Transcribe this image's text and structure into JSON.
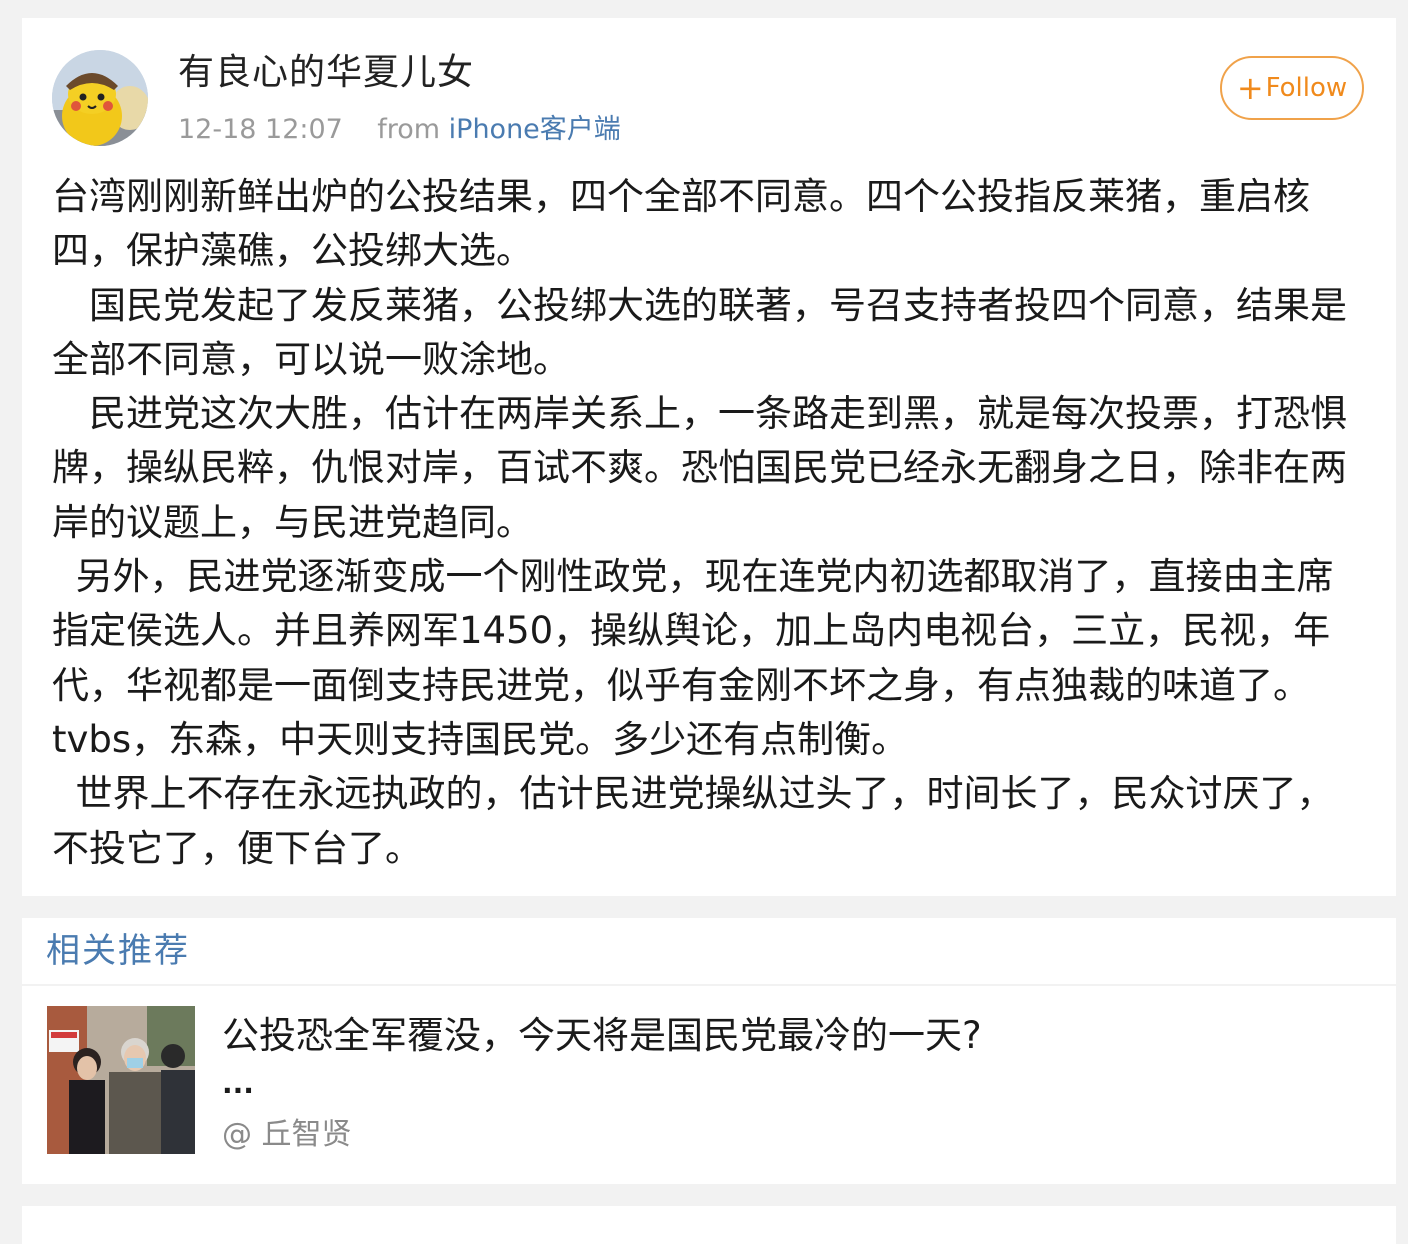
{
  "post": {
    "username": "有良心的华夏儿女",
    "timestamp": "12-18 12:07",
    "from_label": "from",
    "source": "iPhone客户端",
    "follow_label": "Follow",
    "paragraphs": [
      "台湾刚刚新鲜出炉的公投结果，四个全部不同意。四个公投指反莱猪，重启核四，保护藻礁，公投绑大选。",
      "　国民党发起了发反莱猪，公投绑大选的联著，号召支持者投四个同意，结果是全部不同意，可以说一败涂地。",
      "　民进党这次大胜，估计在两岸关系上，一条路走到黑，就是每次投票，打恐惧牌，操纵民粹，仇恨对岸，百试不爽。恐怕国民党已经永无翻身之日，除非在两岸的议题上，与民进党趋同。",
      "  另外，民进党逐渐变成一个刚性政党，现在连党内初选都取消了，直接由主席指定侯选人。并且养网军1450，操纵舆论，加上岛内电视台，三立，民视，年代，华视都是一面倒支持民进党，似乎有金刚不坏之身，有点独裁的味道了。tvbs，东森，中天则支持国民党。多少还有点制衡。",
      "  世界上不存在永远执政的，估计民进党操纵过头了，时间长了，民众讨厌了，不投它了，便下台了。"
    ]
  },
  "related": {
    "section_title": "相关推荐",
    "items": [
      {
        "title": "公投恐全军覆没，今天将是国民党最冷的一天?",
        "ellipsis": "...",
        "author": "@ 丘智贤"
      }
    ]
  },
  "icons": {
    "follow": "plus-icon",
    "avatar": "avatar-image",
    "thumbnail": "news-thumbnail-image"
  },
  "colors": {
    "link_blue": "#4a7bb0",
    "follow_orange": "#f08a1c",
    "meta_gray": "#9a9a9a",
    "background": "#f2f2f2"
  }
}
